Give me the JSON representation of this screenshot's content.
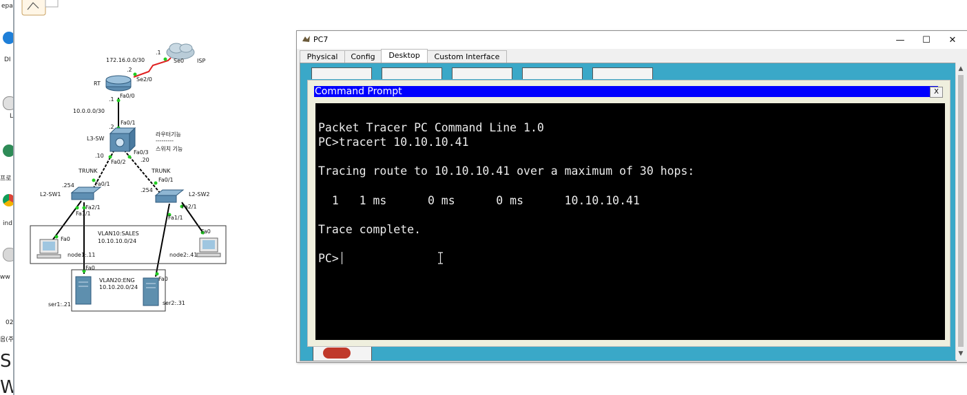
{
  "desktop_strip": {
    "labels": [
      "epa",
      "DI",
      "L",
      "프로",
      "ind",
      "ww",
      "02",
      "음(주",
      "S",
      "W"
    ]
  },
  "topology": {
    "nodes": {
      "isp": "ISP",
      "rt": "RT",
      "l3sw": "L3-SW",
      "l2sw1": "L2-SW1",
      "l2sw2": "L2-SW2",
      "node1": "node1:.11",
      "node2": "node2:.41",
      "ser1": "ser1:.21",
      "ser2": "ser2:.31"
    },
    "labels": {
      "net_wan": "172.16.0.0/30",
      "net_core": "10.0.0.0/30",
      "isp_ip": ".1",
      "rt_se_ip": ".2",
      "isp_port": "Se0",
      "rt_se_port": "Se2/0",
      "rt_fa_port": "Fa0/0",
      "rt_fa_ip": ".1",
      "l3_up_ip": ".2",
      "l3_up_port": "Fa0/1",
      "router_func": "라우터기능",
      "divider": "---------",
      "switch_func": "스위치 기능",
      "l3_left_ip": ".10",
      "l3_left_port": "Fa0/2",
      "l3_right_port": "Fa0/3",
      "l3_right_ip": ".20",
      "trunk_left": "TRUNK",
      "trunk_right": "TRUNK",
      "sw1_ip": ".254",
      "sw1_up": "Fa0/1",
      "sw1_down": "Fa2/1",
      "sw1_down2": "Fa1/1",
      "sw2_ip": ".254",
      "sw2_up": "Fa0/1",
      "sw2_down": "Fa2/1",
      "sw2_down2": "Fa1/1",
      "node1_port": "Fa0",
      "node2_port": "Fa0",
      "ser1_port": "Fa0",
      "ser2_port": "Fa0",
      "vlan10": "VLAN10:SALES",
      "vlan10_net": "10.10.10.0/24",
      "vlan20": "VLAN20:ENG",
      "vlan20_net": "10.10.20.0/24"
    },
    "colors": {
      "serial_link": "#e02020",
      "link": "#000000",
      "port_up": "#22cc22"
    }
  },
  "window": {
    "title": "PC7",
    "controls": {
      "minimize": "—",
      "maximize": "☐",
      "close": "✕"
    },
    "tabs": [
      {
        "label": "Physical",
        "active": false
      },
      {
        "label": "Config",
        "active": false
      },
      {
        "label": "Desktop",
        "active": true
      },
      {
        "label": "Custom Interface",
        "active": false
      }
    ]
  },
  "command_prompt": {
    "title": "Command Prompt",
    "close_label": "X",
    "lines": [
      "Packet Tracer PC Command Line 1.0",
      "PC>tracert 10.10.10.41",
      "",
      "Tracing route to 10.10.10.41 over a maximum of 30 hops:",
      "",
      "  1   1 ms      0 ms      0 ms      10.10.10.41",
      "",
      "Trace complete.",
      "",
      "PC>"
    ]
  },
  "colors": {
    "desktop_bg": "#3aa8c8",
    "cmd_title_bg": "#0000ff",
    "terminal_bg": "#000000",
    "terminal_fg": "#ececec"
  }
}
